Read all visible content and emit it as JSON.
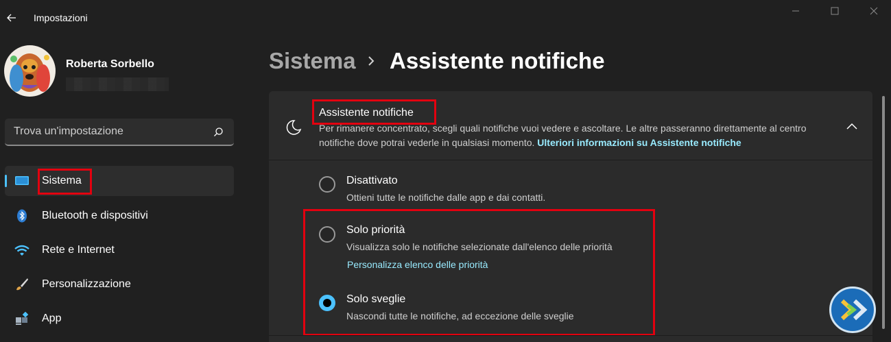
{
  "window": {
    "title": "Impostazioni"
  },
  "user": {
    "name": "Roberta Sorbello"
  },
  "search": {
    "placeholder": "Trova un'impostazione"
  },
  "sidebar": {
    "items": [
      {
        "label": "Sistema",
        "icon": "monitor-icon",
        "selected": true
      },
      {
        "label": "Bluetooth e dispositivi",
        "icon": "bluetooth-icon",
        "selected": false
      },
      {
        "label": "Rete e Internet",
        "icon": "wifi-icon",
        "selected": false
      },
      {
        "label": "Personalizzazione",
        "icon": "brush-icon",
        "selected": false
      },
      {
        "label": "App",
        "icon": "apps-icon",
        "selected": false
      }
    ]
  },
  "breadcrumb": {
    "parent": "Sistema",
    "current": "Assistente notifiche"
  },
  "focus_assist": {
    "title": "Assistente notifiche",
    "description": "Per rimanere concentrato, scegli quali notifiche vuoi vedere e ascoltare. Le altre passeranno direttamente al centro notifiche dove potrai vederle in qualsiasi momento.",
    "learn_more_link": "Ulteriori informazioni su Assistente notifiche",
    "options": [
      {
        "label": "Disattivato",
        "description": "Ottieni tutte le notifiche dalle app e dai contatti.",
        "checked": false
      },
      {
        "label": "Solo priorità",
        "description": "Visualizza solo le notifiche selezionate dall'elenco delle priorità",
        "link": "Personalizza elenco delle priorità",
        "checked": false
      },
      {
        "label": "Solo sveglie",
        "description": "Nascondi tutte le notifiche, ad eccezione delle sveglie",
        "checked": true
      }
    ]
  },
  "colors": {
    "accent": "#4cc2ff",
    "link": "#99ebff",
    "highlight": "#e3000f",
    "background": "#202020",
    "card": "#2b2b2b"
  }
}
